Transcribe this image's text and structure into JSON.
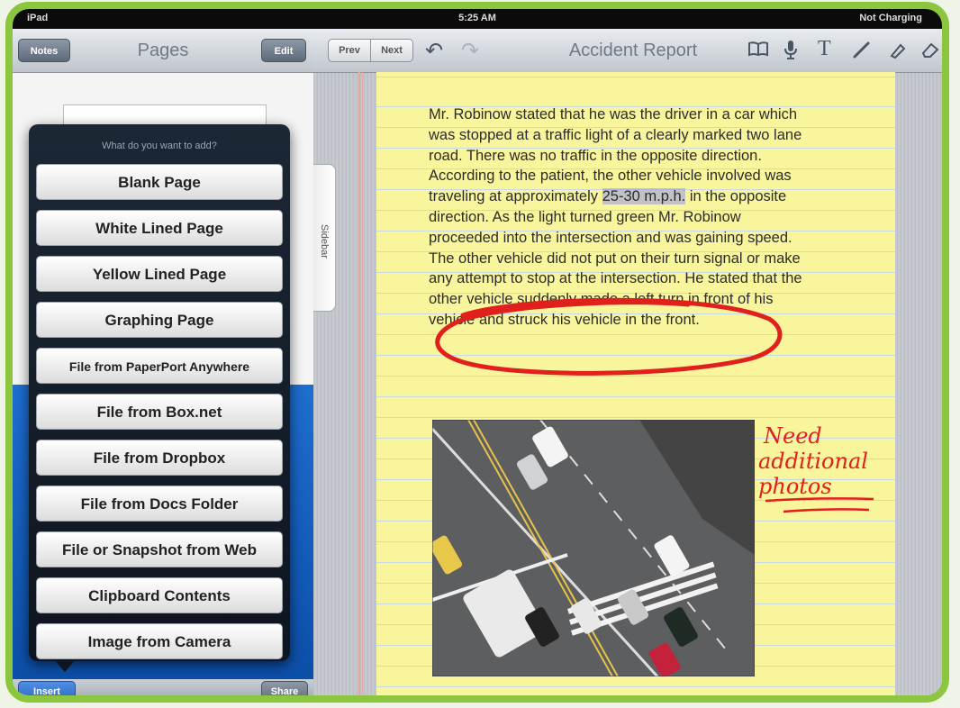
{
  "status": {
    "left": "iPad",
    "time": "5:25 AM",
    "right": "Not Charging"
  },
  "left_pane": {
    "back_label": "Notes",
    "title": "Pages",
    "edit_label": "Edit",
    "insert_label": "Insert",
    "share_label": "Share"
  },
  "popover": {
    "header": "What do you want to add?",
    "items": [
      {
        "label": "Blank Page"
      },
      {
        "label": "White Lined Page"
      },
      {
        "label": "Yellow Lined Page"
      },
      {
        "label": "Graphing Page"
      },
      {
        "label": "File from PaperPort Anywhere"
      },
      {
        "label": "File from Box.net"
      },
      {
        "label": "File from Dropbox"
      },
      {
        "label": "File from Docs Folder"
      },
      {
        "label": "File or Snapshot from Web"
      },
      {
        "label": "Clipboard Contents"
      },
      {
        "label": "Image from Camera"
      }
    ]
  },
  "right_pane": {
    "prev_label": "Prev",
    "next_label": "Next",
    "title": "Accident Report",
    "sidebar_label": "Sidebar",
    "tools": [
      "book-icon",
      "microphone-icon",
      "text-icon",
      "pen-icon",
      "highlighter-icon",
      "eraser-icon"
    ]
  },
  "note": {
    "lines": [
      "Mr. Robinow stated that he was the driver in a car which",
      "was stopped at a traffic light of a clearly marked two lane",
      "road. There was no traffic in the opposite direction.",
      "According to the patient, the other vehicle involved was",
      "traveling at approximately",
      "25-30 m.p.h.",
      "in the opposite",
      "direction.  As the light turned green Mr. Robinow",
      "proceeded into the intersection and was gaining speed.",
      "The other vehicle did not put on their turn signal or make",
      "any attempt to stop at the intersection.  He stated that the",
      "other vehicle suddenly made a left turn in front of his",
      "vehicle and struck his vehicle in the front."
    ],
    "handwriting": [
      "Need",
      "additional",
      "photos"
    ]
  },
  "colors": {
    "frame": "#8cc63f",
    "paper": "#f9f59c",
    "ink": "#e0201c",
    "highlight": "#9696e6"
  }
}
